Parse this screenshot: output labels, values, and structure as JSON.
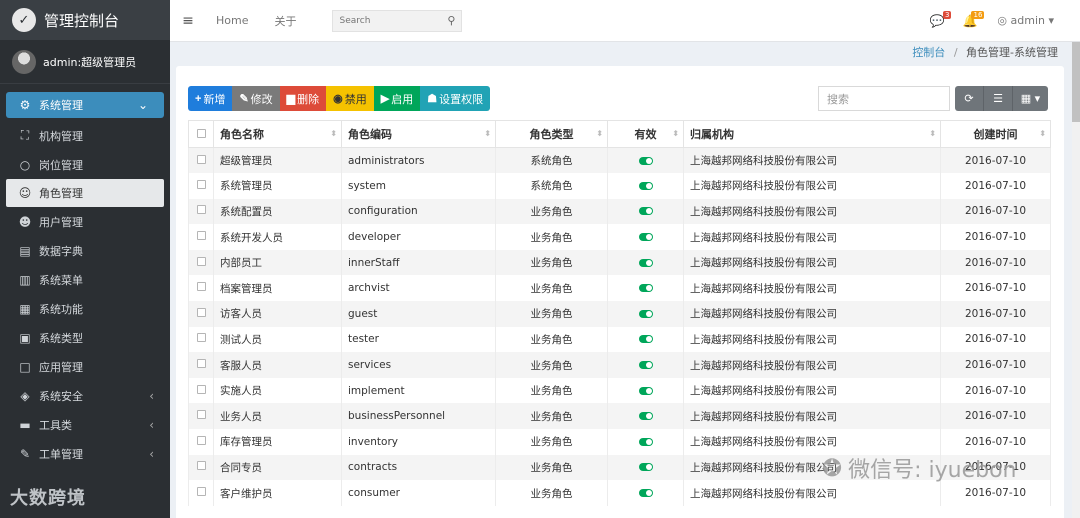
{
  "brand": {
    "title": "管理控制台",
    "logo_icon": "bird-logo"
  },
  "user_panel": {
    "name": "admin:超级管理员"
  },
  "sidebar": {
    "items": [
      {
        "label": "系统管理",
        "icon": "gear-icon",
        "glyph": "⚙",
        "arrow": "⌄",
        "state": "active-parent"
      },
      {
        "label": "机构管理",
        "icon": "sitemap-icon",
        "glyph": "⛶",
        "state": ""
      },
      {
        "label": "岗位管理",
        "icon": "circle-icon",
        "glyph": "○",
        "state": ""
      },
      {
        "label": "角色管理",
        "icon": "user-cog-icon",
        "glyph": "☺",
        "state": "active"
      },
      {
        "label": "用户管理",
        "icon": "users-icon",
        "glyph": "☻",
        "state": ""
      },
      {
        "label": "数据字典",
        "icon": "book-icon",
        "glyph": "▤",
        "state": ""
      },
      {
        "label": "系统菜单",
        "icon": "open-book-icon",
        "glyph": "▥",
        "state": ""
      },
      {
        "label": "系统功能",
        "icon": "copy-icon",
        "glyph": "▦",
        "state": ""
      },
      {
        "label": "系统类型",
        "icon": "archive-icon",
        "glyph": "▣",
        "state": ""
      },
      {
        "label": "应用管理",
        "icon": "square-icon",
        "glyph": "□",
        "state": ""
      },
      {
        "label": "系统安全",
        "icon": "shield-icon",
        "glyph": "◈",
        "arrow": "‹",
        "state": ""
      },
      {
        "label": "工具类",
        "icon": "briefcase-icon",
        "glyph": "▬",
        "arrow": "‹",
        "state": ""
      },
      {
        "label": "工单管理",
        "icon": "ticket-icon",
        "glyph": "✎",
        "arrow": "‹",
        "state": ""
      }
    ]
  },
  "watermark_left": "大数跨境",
  "header": {
    "menu_icon": "≡",
    "home": "Home",
    "about": "关于",
    "search_placeholder": "Search",
    "messages_badge": "3",
    "notifications_badge": "16",
    "user": "admin ▾"
  },
  "breadcrumb": {
    "root": "控制台",
    "sep": "/",
    "current": "角色管理-系统管理"
  },
  "toolbar": {
    "add": "新增",
    "edit": "修改",
    "delete": "删除",
    "disable": "禁用",
    "enable": "启用",
    "permissions": "设置权限"
  },
  "table_search_placeholder": "搜索",
  "table": {
    "columns": [
      "角色名称",
      "角色编码",
      "角色类型",
      "有效",
      "归属机构",
      "创建时间"
    ],
    "rows": [
      {
        "name": "超级管理员",
        "code": "administrators",
        "type": "系统角色",
        "org": "上海越邦网络科技股份有限公司",
        "created": "2016-07-10"
      },
      {
        "name": "系统管理员",
        "code": "system",
        "type": "系统角色",
        "org": "上海越邦网络科技股份有限公司",
        "created": "2016-07-10"
      },
      {
        "name": "系统配置员",
        "code": "configuration",
        "type": "业务角色",
        "org": "上海越邦网络科技股份有限公司",
        "created": "2016-07-10"
      },
      {
        "name": "系统开发人员",
        "code": "developer",
        "type": "业务角色",
        "org": "上海越邦网络科技股份有限公司",
        "created": "2016-07-10"
      },
      {
        "name": "内部员工",
        "code": "innerStaff",
        "type": "业务角色",
        "org": "上海越邦网络科技股份有限公司",
        "created": "2016-07-10"
      },
      {
        "name": "档案管理员",
        "code": "archvist",
        "type": "业务角色",
        "org": "上海越邦网络科技股份有限公司",
        "created": "2016-07-10"
      },
      {
        "name": "访客人员",
        "code": "guest",
        "type": "业务角色",
        "org": "上海越邦网络科技股份有限公司",
        "created": "2016-07-10"
      },
      {
        "name": "测试人员",
        "code": "tester",
        "type": "业务角色",
        "org": "上海越邦网络科技股份有限公司",
        "created": "2016-07-10"
      },
      {
        "name": "客服人员",
        "code": "services",
        "type": "业务角色",
        "org": "上海越邦网络科技股份有限公司",
        "created": "2016-07-10"
      },
      {
        "name": "实施人员",
        "code": "implement",
        "type": "业务角色",
        "org": "上海越邦网络科技股份有限公司",
        "created": "2016-07-10"
      },
      {
        "name": "业务人员",
        "code": "businessPersonnel",
        "type": "业务角色",
        "org": "上海越邦网络科技股份有限公司",
        "created": "2016-07-10"
      },
      {
        "name": "库存管理员",
        "code": "inventory",
        "type": "业务角色",
        "org": "上海越邦网络科技股份有限公司",
        "created": "2016-07-10"
      },
      {
        "name": "合同专员",
        "code": "contracts",
        "type": "业务角色",
        "org": "上海越邦网络科技股份有限公司",
        "created": "2016-07-10"
      },
      {
        "name": "客户维护员",
        "code": "consumer",
        "type": "业务角色",
        "org": "上海越邦网络科技股份有限公司",
        "created": "2016-07-10"
      }
    ]
  },
  "watermark_right": "微信号: iyuebon"
}
